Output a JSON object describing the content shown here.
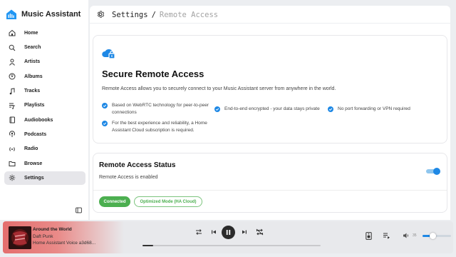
{
  "app": {
    "title": "Music Assistant"
  },
  "sidebar": {
    "items": [
      {
        "label": "Home",
        "icon": "home-icon",
        "active": false
      },
      {
        "label": "Search",
        "icon": "search-icon",
        "active": false
      },
      {
        "label": "Artists",
        "icon": "person-icon",
        "active": false
      },
      {
        "label": "Albums",
        "icon": "album-icon",
        "active": false
      },
      {
        "label": "Tracks",
        "icon": "music-note-icon",
        "active": false
      },
      {
        "label": "Playlists",
        "icon": "playlist-icon",
        "active": false
      },
      {
        "label": "Audiobooks",
        "icon": "book-icon",
        "active": false
      },
      {
        "label": "Podcasts",
        "icon": "podcast-icon",
        "active": false
      },
      {
        "label": "Radio",
        "icon": "radio-icon",
        "active": false
      },
      {
        "label": "Browse",
        "icon": "folder-icon",
        "active": false
      },
      {
        "label": "Settings",
        "icon": "gear-icon",
        "active": true
      }
    ]
  },
  "header": {
    "crumb_root": "Settings",
    "separator": "/",
    "crumb_current": "Remote Access"
  },
  "remote_card": {
    "title": "Secure Remote Access",
    "description": "Remote Access allows you to securely connect to your Music Assistant server from anywhere in the world.",
    "features": [
      "Based on WebRTC technology for peer-to-peer connections",
      "End-to-end encrypted - your data stays private",
      "No port forwarding or VPN required",
      "For the best experience and reliability, a Home Assistant Cloud subscription is required."
    ]
  },
  "status_card": {
    "title": "Remote Access Status",
    "subtitle": "Remote Access is enabled",
    "enabled": true,
    "badge_connected": "Connected",
    "badge_mode": "Optimized Mode (HA Cloud)"
  },
  "player": {
    "track_title": "Around the World",
    "artist": "Daft Punk",
    "source": "Home Assistant Voice a3d68...",
    "progress": 0.06,
    "volume": 35,
    "volume_label": "35"
  },
  "colors": {
    "accent": "#1e88e5",
    "success": "#4caf50",
    "player_gradient": "#e46e6e"
  }
}
